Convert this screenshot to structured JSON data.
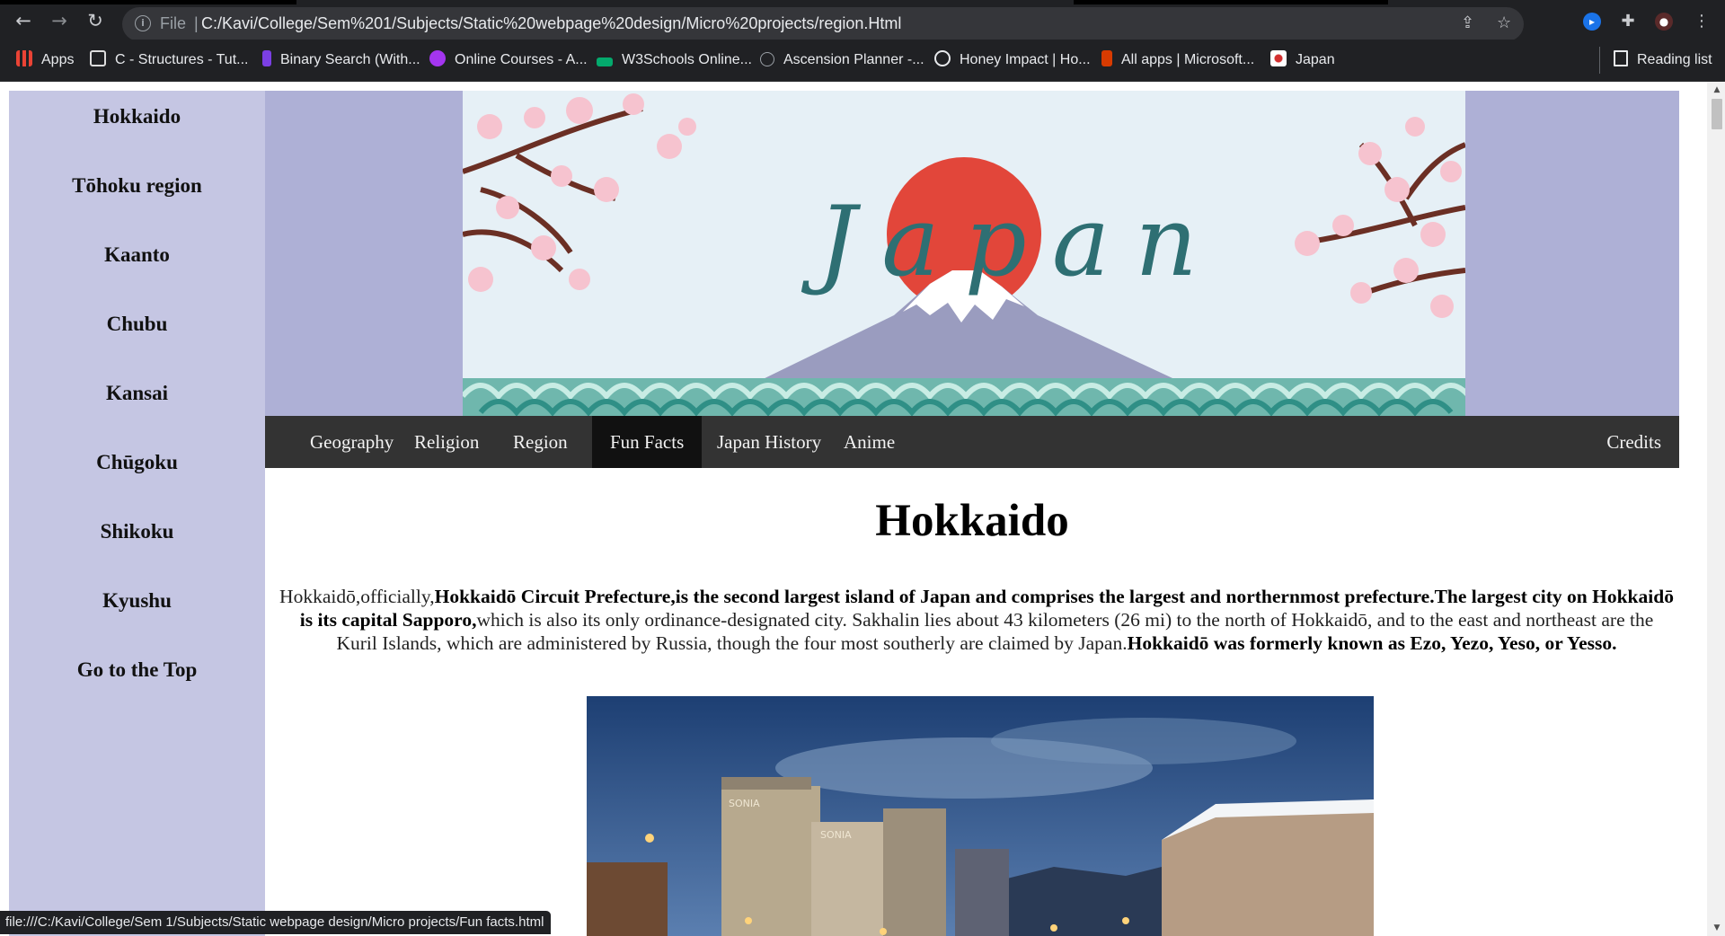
{
  "browser": {
    "file_label": "File",
    "url": "C:/Kavi/College/Sem%201/Subjects/Static%20webpage%20design/Micro%20projects/region.Html",
    "status_url": "file:///C:/Kavi/College/Sem 1/Subjects/Static webpage design/Micro projects/Fun facts.html",
    "bookmarks": [
      {
        "label": "Apps",
        "icon": "apps-grid-icon"
      },
      {
        "label": "C - Structures - Tut...",
        "icon": "tutorial-site-icon"
      },
      {
        "label": "Binary Search (With...",
        "icon": "programiz-icon"
      },
      {
        "label": "Online Courses - A...",
        "icon": "udemy-icon"
      },
      {
        "label": "W3Schools Online...",
        "icon": "w3schools-icon"
      },
      {
        "label": "Ascension Planner -...",
        "icon": "genshin-center-icon"
      },
      {
        "label": "Honey Impact | Ho...",
        "icon": "globe-icon"
      },
      {
        "label": "All apps | Microsoft...",
        "icon": "office-icon"
      },
      {
        "label": "Japan",
        "icon": "japan-flag-icon"
      }
    ],
    "reading_list": "Reading list"
  },
  "sidebar": {
    "items": [
      "Hokkaido",
      "Tōhoku region",
      "Kaanto",
      "Chubu",
      "Kansai",
      "Chūgoku",
      "Shikoku",
      "Kyushu",
      "Go to the Top"
    ]
  },
  "banner": {
    "title": "Japan"
  },
  "nav": {
    "tabs": [
      "Geography",
      "Religion",
      "Region",
      "Fun Facts",
      "Japan History",
      "Anime"
    ],
    "active": "Fun Facts",
    "credits": "Credits"
  },
  "main": {
    "title": "Hokkaido",
    "para": {
      "p1": "Hokkaidō,officially,",
      "b1": "Hokkaidō Circuit Prefecture,is the second largest island of Japan and comprises the largest and northernmost prefecture.The largest city on Hokkaidō is its capital Sapporo,",
      "p2": "which is also its only ordinance-designated city. Sakhalin lies about 43 kilometers (26 mi) to the north of Hokkaidō, and to the east and northeast are the Kuril Islands, which are administered by Russia, though the four most southerly are claimed by Japan.",
      "b2": "Hokkaidō was formerly known as Ezo, Yezo, Yeso, or Yesso."
    },
    "photo_signs": [
      "SONIA",
      "SONIA"
    ]
  }
}
